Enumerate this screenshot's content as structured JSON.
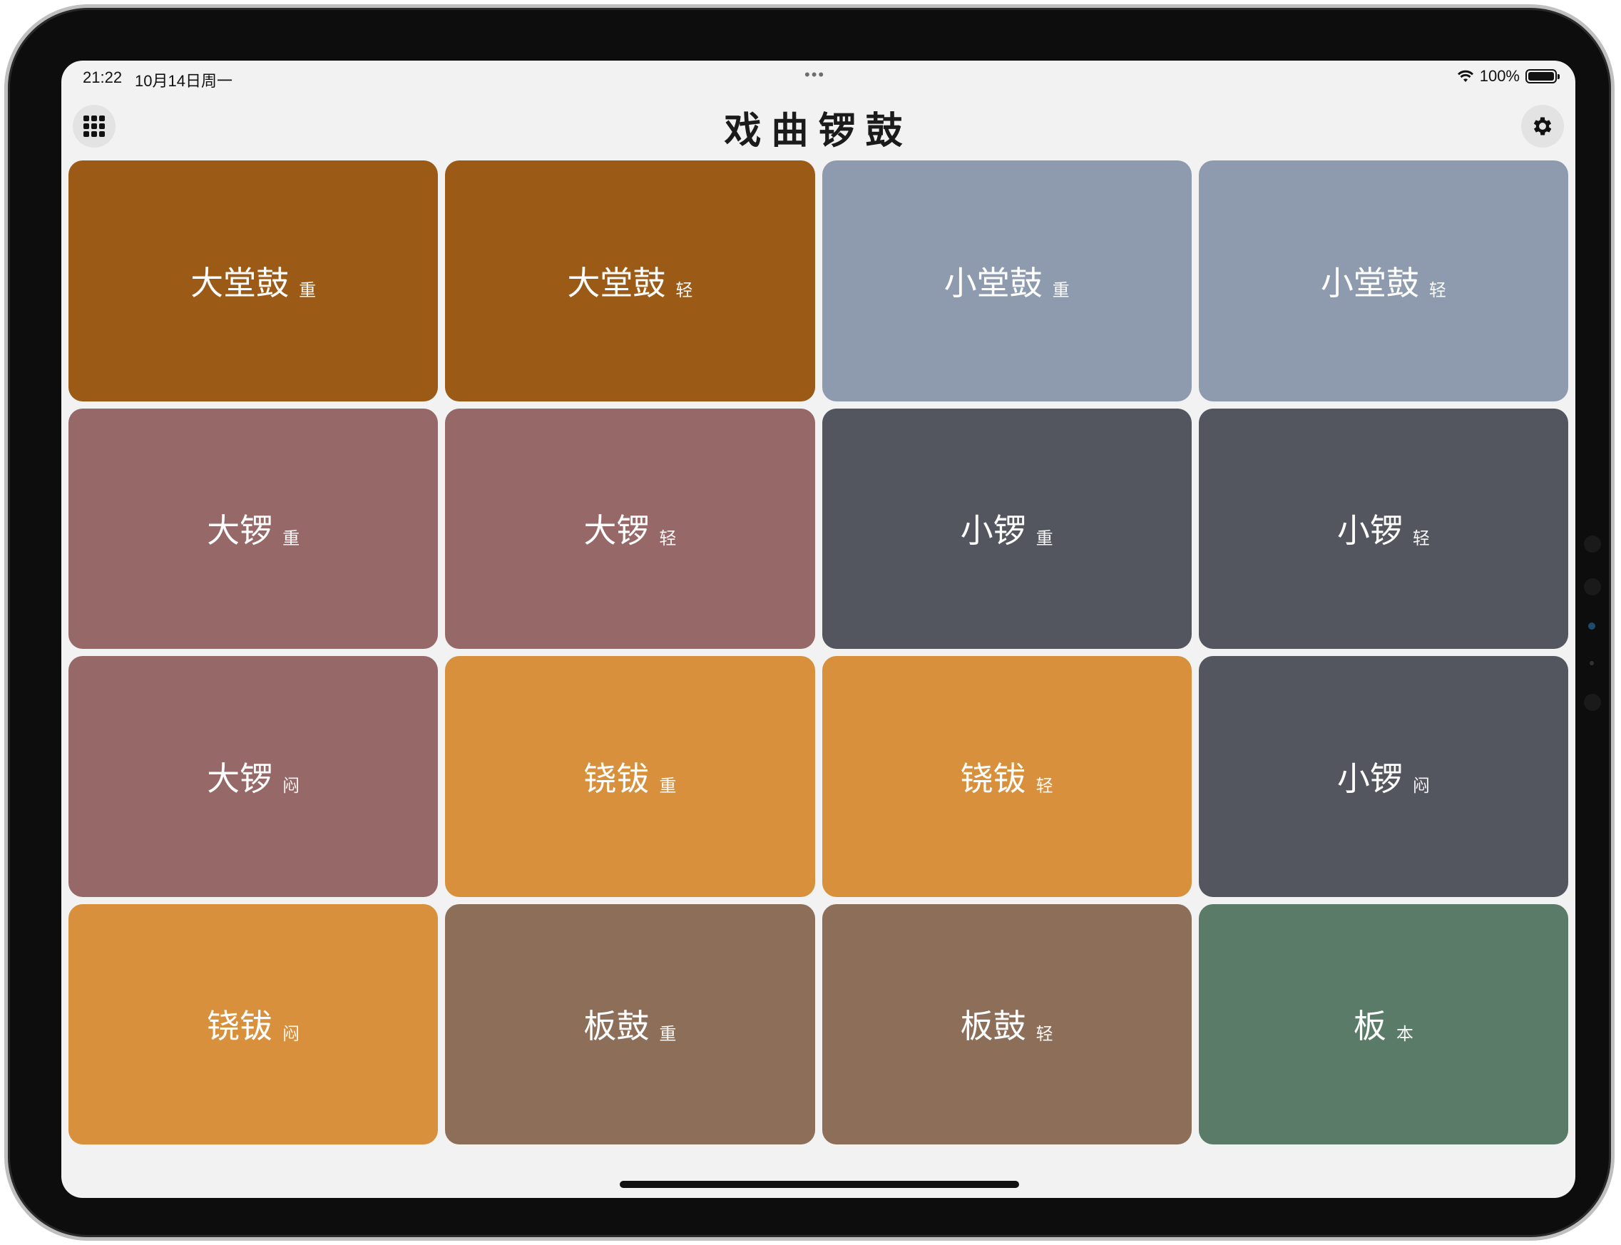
{
  "status_bar": {
    "time": "21:22",
    "date": "10月14日周一",
    "multitask_dots": "•••",
    "battery_text": "100%"
  },
  "header": {
    "title": "戏曲锣鼓",
    "left_icon": "grid-icon",
    "right_icon": "gear-icon"
  },
  "colors": {
    "brown": "#9c5a17",
    "slate_light": "#8e9baf",
    "rose": "#976868",
    "charcoal": "#53565f",
    "orange": "#d8903c",
    "taupe": "#8d6e58",
    "green": "#5b7b69"
  },
  "pads": [
    {
      "name": "大堂鼓",
      "mod": "重",
      "color": "#9c5a17"
    },
    {
      "name": "大堂鼓",
      "mod": "轻",
      "color": "#9c5a17"
    },
    {
      "name": "小堂鼓",
      "mod": "重",
      "color": "#8e9baf"
    },
    {
      "name": "小堂鼓",
      "mod": "轻",
      "color": "#8e9baf"
    },
    {
      "name": "大锣",
      "mod": "重",
      "color": "#976868"
    },
    {
      "name": "大锣",
      "mod": "轻",
      "color": "#976868"
    },
    {
      "name": "小锣",
      "mod": "重",
      "color": "#53565f"
    },
    {
      "name": "小锣",
      "mod": "轻",
      "color": "#53565f"
    },
    {
      "name": "大锣",
      "mod": "闷",
      "color": "#976868"
    },
    {
      "name": "铙钹",
      "mod": "重",
      "color": "#d8903c"
    },
    {
      "name": "铙钹",
      "mod": "轻",
      "color": "#d8903c"
    },
    {
      "name": "小锣",
      "mod": "闷",
      "color": "#53565f"
    },
    {
      "name": "铙钹",
      "mod": "闷",
      "color": "#d8903c"
    },
    {
      "name": "板鼓",
      "mod": "重",
      "color": "#8d6e58"
    },
    {
      "name": "板鼓",
      "mod": "轻",
      "color": "#8d6e58"
    },
    {
      "name": "板",
      "mod": "本",
      "color": "#5b7b69"
    }
  ]
}
